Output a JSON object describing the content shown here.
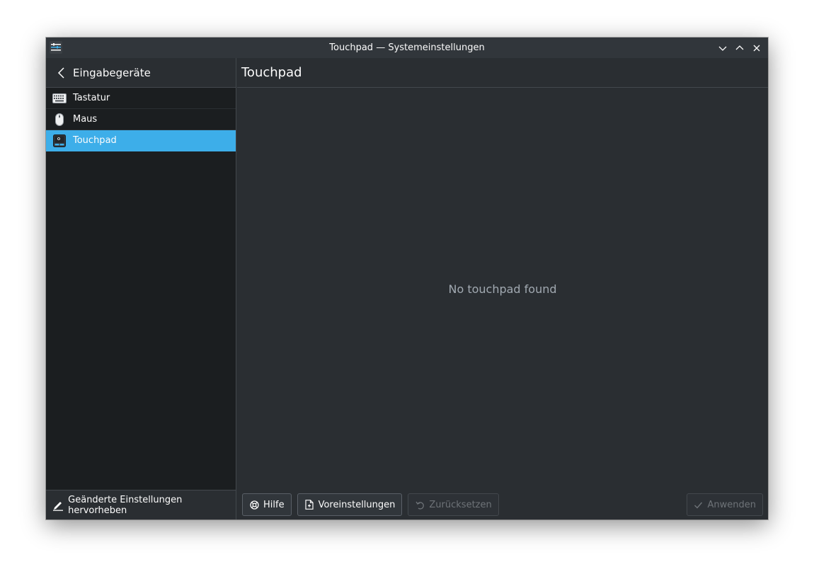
{
  "window": {
    "title": "Touchpad — Systemeinstellungen"
  },
  "sidebar": {
    "header": "Eingabegeräte",
    "items": [
      {
        "label": "Tastatur",
        "icon": "keyboard-icon",
        "active": false
      },
      {
        "label": "Maus",
        "icon": "mouse-icon",
        "active": false
      },
      {
        "label": "Touchpad",
        "icon": "touchpad-icon",
        "active": true
      }
    ],
    "footer_label": "Geänderte Einstellungen hervorheben"
  },
  "main": {
    "title": "Touchpad",
    "empty_message": "No touchpad found"
  },
  "buttons": {
    "help": "Hilfe",
    "defaults": "Voreinstellungen",
    "reset": "Zurücksetzen",
    "apply": "Anwenden"
  },
  "colors": {
    "accent": "#3daee9",
    "window_bg": "#2a2e32",
    "sidebar_bg": "#1b1e20",
    "text": "#fcfcfc",
    "muted_text": "#a1a9b1"
  }
}
